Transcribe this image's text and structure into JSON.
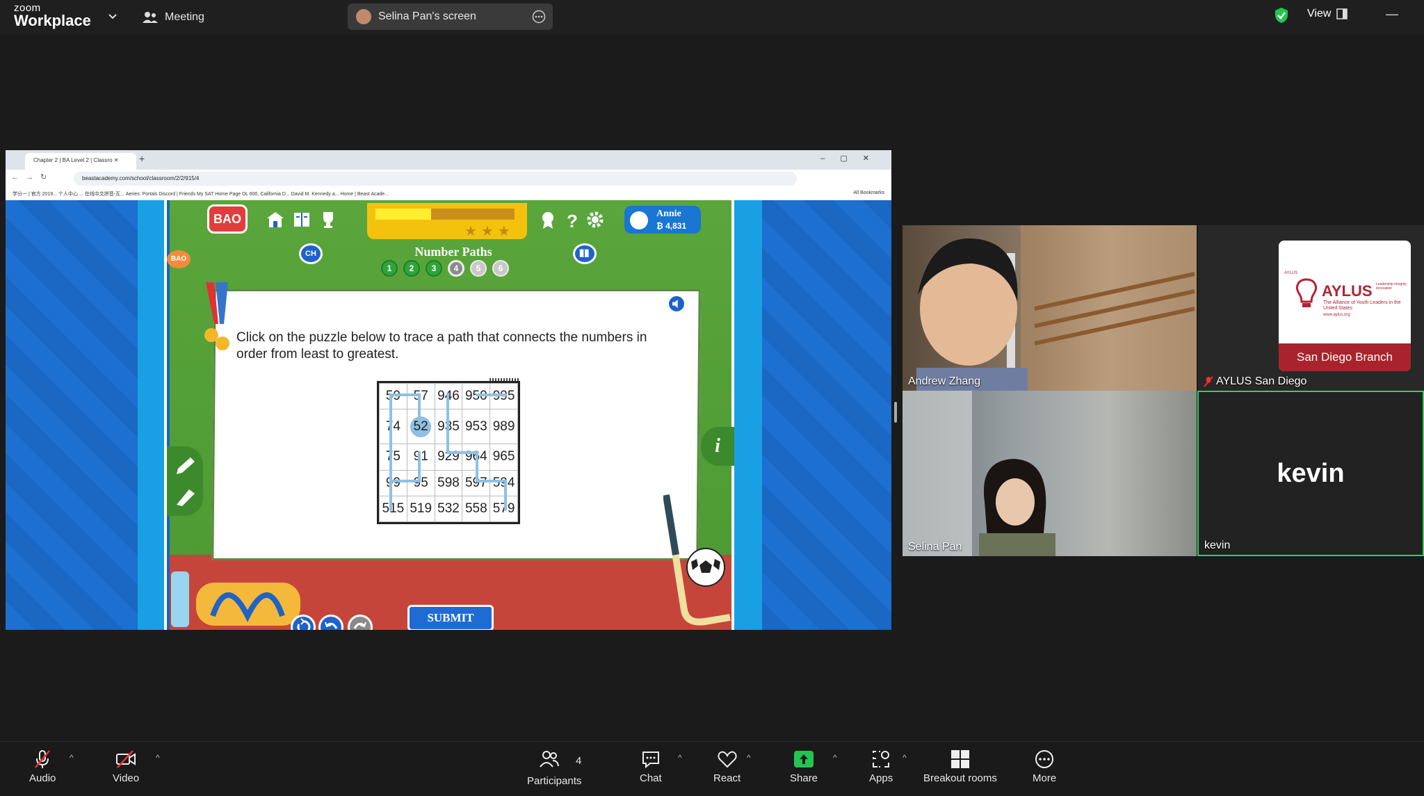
{
  "topbar": {
    "logo_line1": "zoom",
    "logo_line2": "Workplace",
    "meeting_label": "Meeting",
    "screen_share_label": "Selina Pan's screen",
    "view_label": "View"
  },
  "browser": {
    "tab_title": "Chapter 2 | BA Level 2 | Classro",
    "url": "beastacademy.com/school/classroom/2/2/915/4",
    "bookmarks": "学分一 | 官方 2019...   个人中心   ... 在线中文拼音-互...   Aeries: Portals   Discord | Friends   My SAT Home Page   DL 600, California D...   David M. Kennedy a...   Home | Beast Acade...",
    "all_bookmarks": "All Bookmarks"
  },
  "game": {
    "bao_label": "BAO",
    "user_name": "Annie",
    "user_bucks": "₿ 4,831",
    "chapter_label": "CH",
    "puzzle_title": "Number Paths",
    "dots": [
      "1",
      "2",
      "3",
      "4",
      "5",
      "6"
    ],
    "prompt": "Click on the puzzle below to trace a path that connects the numbers in order from least to greatest.",
    "grid": [
      [
        "59",
        "57",
        "946",
        "950",
        "995"
      ],
      [
        "74",
        "52",
        "935",
        "953",
        "989"
      ],
      [
        "75",
        "91",
        "929",
        "964",
        "965"
      ],
      [
        "99",
        "95",
        "598",
        "597",
        "594"
      ],
      [
        "515",
        "519",
        "532",
        "558",
        "579"
      ]
    ],
    "selected_cell": "52",
    "submit_label": "SUBMIT",
    "info_label": "i",
    "stars_earned": 0,
    "stars_total": 3
  },
  "participants": [
    {
      "name": "Andrew Zhang"
    },
    {
      "name": "AYLUS San Diego",
      "muted": true
    },
    {
      "name": "Selina Pan"
    },
    {
      "name": "kevin",
      "display": "kevin"
    }
  ],
  "aylus": {
    "small": "AYLUS",
    "name": "AYLUS",
    "tag": "Leadership Integrity Innovation",
    "desc": "The Alliance of Youth Leaders in the United States",
    "site": "www.aylus.org",
    "branch": "San Diego Branch"
  },
  "toolbar": {
    "audio": "Audio",
    "video": "Video",
    "participants": "Participants",
    "participants_count": "4",
    "chat": "Chat",
    "react": "React",
    "share": "Share",
    "apps": "Apps",
    "breakout": "Breakout rooms",
    "more": "More"
  },
  "colors": {
    "share_green": "#23c552",
    "active_speaker_border": "#2fd160",
    "game_blue": "#1e63c7"
  }
}
